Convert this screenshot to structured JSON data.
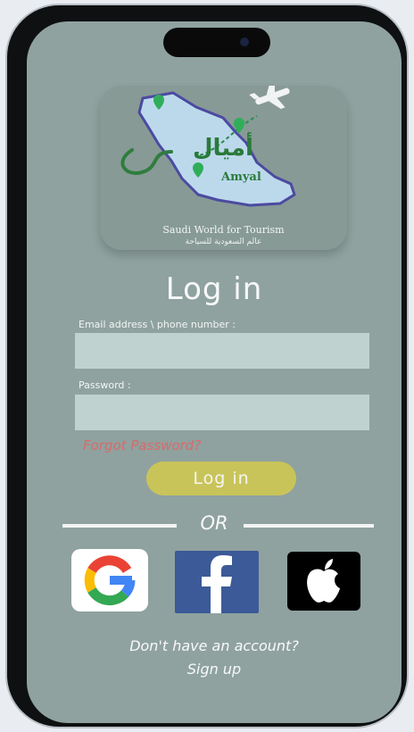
{
  "brand": {
    "name_ar": "أميال",
    "name_en": "Amyal",
    "tagline_en": "Saudi World for Tourism",
    "tagline_ar": "عالم السعودية للسياحة"
  },
  "login": {
    "title": "Log in",
    "email_label": "Email address \\ phone number :",
    "email_value": "",
    "password_label": "Password :",
    "password_value": "",
    "forgot_label": "Forgot Password?",
    "submit_label": "Log in"
  },
  "divider": {
    "label": "OR"
  },
  "social": {
    "google": "google-icon",
    "facebook": "facebook-icon",
    "apple": "apple-icon"
  },
  "signup": {
    "prompt": "Don't have an account?",
    "link": "Sign up"
  },
  "colors": {
    "screen_bg": "#8fa29f",
    "input_bg": "#bfd2cf",
    "button_bg": "#c9c45a",
    "forgot": "#d96a6a",
    "facebook": "#3b5a97"
  }
}
